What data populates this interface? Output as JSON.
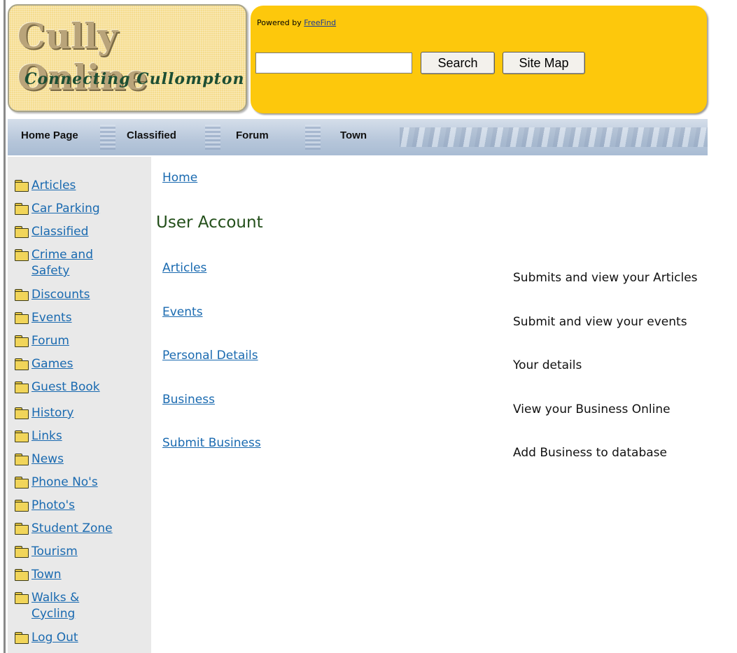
{
  "header": {
    "logo_title": "Cully Online",
    "logo_subtitle": "Connecting Cullompton",
    "powered_by_label": "Powered by",
    "powered_by_link": "FreeFind",
    "search_value": "",
    "search_button": "Search",
    "sitemap_button": "Site Map"
  },
  "nav": {
    "items": [
      "Home Page",
      "Classified",
      "Forum",
      "Town"
    ]
  },
  "sidebar": {
    "items": [
      {
        "label": "Articles"
      },
      {
        "label": "Car Parking"
      },
      {
        "label": "Classified"
      },
      {
        "label": "Crime and Safety"
      },
      {
        "label": "Discounts"
      },
      {
        "label": "Events"
      },
      {
        "label": "Forum"
      },
      {
        "label": "Games"
      },
      {
        "label": "Guest Book"
      },
      {
        "label": "History"
      },
      {
        "label": "Links"
      },
      {
        "label": "News"
      },
      {
        "label": "Phone No's"
      },
      {
        "label": "Photo's"
      },
      {
        "label": "Student Zone"
      },
      {
        "label": "Tourism"
      },
      {
        "label": "Town"
      },
      {
        "label": "Walks & Cycling"
      },
      {
        "label": "Log Out"
      }
    ],
    "crime_line1": "Crime and",
    "crime_line2": "Safety",
    "walks_line1": "Walks &",
    "walks_line2": "Cycling"
  },
  "main": {
    "breadcrumb": "Home",
    "title": "User Account",
    "rows": [
      {
        "link": "Articles",
        "description": "Submits and view your Articles"
      },
      {
        "link": "Events",
        "description": "Submit and view your events"
      },
      {
        "link": "Personal Details",
        "description": "Your details"
      },
      {
        "link": "Business",
        "description": "View your Business Online"
      },
      {
        "link": "Submit Business",
        "description": "Add Business to database"
      }
    ]
  },
  "colors": {
    "logo_bg": "#f5dc8e",
    "search_bg": "#fdc80c",
    "nav_bg": "#b6c6da",
    "sidebar_bg": "#e9e9e9",
    "link": "#1a6ab0",
    "title_green": "#234f1a"
  },
  "icons": {
    "sidebar_item_icon": "folder-icon"
  }
}
